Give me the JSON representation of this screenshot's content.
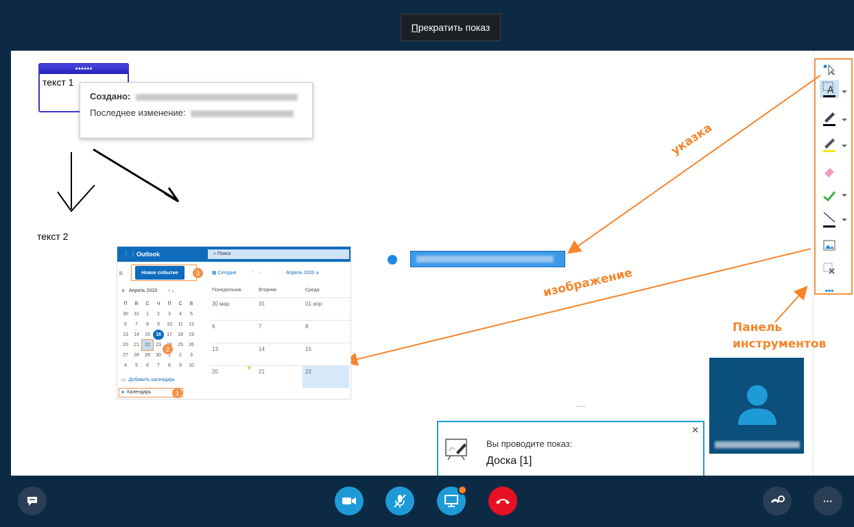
{
  "header": {
    "stop_label": "Прекратить показ",
    "stop_underline": "П",
    "stop_rest": "рекратить показ"
  },
  "whiteboard": {
    "card_text": "текст 1",
    "tooltip": {
      "created_label": "Создано:",
      "modified_label": "Последнее изменение:"
    },
    "text2": "текст 2",
    "annotations": {
      "pointer": "указка",
      "image": "изображение",
      "panel_line1": "Панель",
      "panel_line2": "инструментов"
    }
  },
  "outlook": {
    "app_name": "Outlook",
    "search_placeholder": "Поиск",
    "new_event": "Новое событие",
    "today": "Сегодня",
    "month_label": "Апрель 2020",
    "mini_month": "Апрель 2020",
    "weekdays": [
      "П",
      "В",
      "С",
      "Ч",
      "П",
      "С",
      "В"
    ],
    "weeks": [
      [
        "30",
        "31",
        "1",
        "2",
        "3",
        "4",
        "5"
      ],
      [
        "6",
        "7",
        "8",
        "9",
        "10",
        "11",
        "12"
      ],
      [
        "13",
        "14",
        "15",
        "16",
        "17",
        "18",
        "19"
      ],
      [
        "20",
        "21",
        "22",
        "23",
        "24",
        "25",
        "26"
      ],
      [
        "27",
        "28",
        "29",
        "30",
        "1",
        "2",
        "3"
      ],
      [
        "4",
        "5",
        "6",
        "7",
        "8",
        "9",
        "10"
      ]
    ],
    "col_headers": [
      "Понедельник",
      "Вторник",
      "Среда"
    ],
    "rows": [
      [
        "30 мар",
        "31",
        "01 апр"
      ],
      [
        "6",
        "7",
        "8"
      ],
      [
        "13",
        "14",
        "15"
      ],
      [
        "20",
        "21",
        "22"
      ]
    ],
    "add_calendar": "Добавить календарь",
    "calendar_label": "Календарь",
    "badges": [
      "1",
      "2",
      "3"
    ]
  },
  "toolbar": {
    "more": "•••"
  },
  "popup": {
    "line1": "Вы проводите показ:",
    "line2": "Доска [1]",
    "close": "✕"
  },
  "colors": {
    "accent": "#1e9bd7",
    "orange": "#f7842a",
    "end_call": "#e81123",
    "bar_bg": "#0d2a45"
  }
}
